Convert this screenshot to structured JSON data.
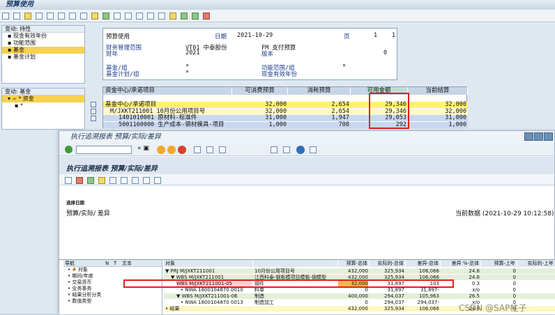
{
  "win1": {
    "title": "预算使用",
    "tree1": {
      "header": "变动: 持性",
      "items": [
        "现金有效年份",
        "功能范围",
        "基金",
        "基金计划"
      ],
      "selected_index": 2
    },
    "tree2": {
      "header": "变动: 基金",
      "items": [
        "* 资金",
        "*"
      ]
    },
    "header_panel": {
      "title": "预算使用",
      "date_label": "日期",
      "date": "2021-10-29",
      "page_label": "页",
      "page": "1",
      "page_of": "1",
      "fm_area_label": "财务管理范围",
      "fm_area": "VT01 中泰股份",
      "fm_label": "FM 支付预算",
      "year_label": "财年",
      "year": "2021",
      "version_label": "版本",
      "version": "0",
      "fund_label": "基金/组",
      "fund": "*",
      "func_label": "功能范围/组",
      "func": "*",
      "fundplan_label": "基金计划/组",
      "fundplan": "*",
      "valid_label": "现金有效年份"
    },
    "grid": {
      "headers": [
        "资金中心/承诺项目",
        "可消费预算",
        "消耗预算",
        "可用金额",
        "当前结算"
      ],
      "rows": [
        {
          "c0": "基金中心/承诺项目",
          "c1": "32,000",
          "c2": "2,654",
          "c3": "29,346",
          "c4": "32,000",
          "style": "yellow"
        },
        {
          "c0": "M/JXKT211001   10月份公用项目号",
          "c1": "32,000",
          "c2": "2,654",
          "c3": "29,346",
          "c4": "32,000",
          "style": "lightyellow"
        },
        {
          "c0": "1401010001   原材料-标准件",
          "c1": "31,000",
          "c2": "1,947",
          "c3": "29,053",
          "c4": "31,000",
          "style": "blue"
        },
        {
          "c0": "5001160000   生产成本-钢材模具-项目",
          "c1": "1,000",
          "c2": "708",
          "c3": "292",
          "c4": "1,000",
          "style": "blue"
        }
      ]
    }
  },
  "win2": {
    "title": "执行追溯报表 预算/实际/差异",
    "heading": "执行追溯报表 预算/实际/差异",
    "section_label": "选择日期",
    "subtitle": "预算/实际/ 差异",
    "current_data": "当前数据 (2021-10-29 10:12:58)",
    "nav": {
      "headers": [
        "导航",
        "N",
        "T",
        "文本"
      ],
      "items": [
        "对象",
        "期间/年度",
        "交易货币",
        "业务事务",
        "结果分析分类",
        "数值类型"
      ]
    },
    "grid": {
      "headers": [
        "对象",
        "",
        "预算-总体",
        "实际的-总体",
        "差异-总体",
        "差异 %-总体",
        "预算-上年",
        "实际的-上年"
      ],
      "rows": [
        {
          "obj": "▼ PRJ M/JXKT211001",
          "txt": "10月份公用项目号",
          "b": "432,000",
          "a": "325,934",
          "d": "106,066",
          "p": "24.6",
          "by": "0",
          "ay": "",
          "style": "lightgreen",
          "indent": 0
        },
        {
          "obj": "▼ WBS M/JXKT211001",
          "txt": "江西科泰-钢板模项目模板-钢模型",
          "b": "432,000",
          "a": "325,934",
          "d": "106,066",
          "p": "24.6",
          "by": "0",
          "ay": "",
          "style": "lightgreen",
          "indent": 8
        },
        {
          "obj": "WBS M/JXKT211001-05",
          "txt": "钢件",
          "b": "32,000",
          "a": "31,897",
          "d": "103",
          "p": "0.3",
          "by": "0",
          "ay": "",
          "style": "selected",
          "indent": 16
        },
        {
          "obj": "• NWA 1800104870 0010",
          "txt": "料单",
          "b": "0",
          "a": "31,897",
          "d": "31,897-",
          "p": "x/o",
          "by": "0",
          "ay": "",
          "style": "white",
          "indent": 22
        },
        {
          "obj": "▼ WBS M/JXKT211001-06",
          "txt": "制造",
          "b": "400,000",
          "a": "294,037",
          "d": "105,963",
          "p": "26.5",
          "by": "0",
          "ay": "",
          "style": "lightgreen",
          "indent": 16
        },
        {
          "obj": "• NWA 1800104870 0013",
          "txt": "制造加工",
          "b": "0",
          "a": "294,037",
          "d": "294,037-",
          "p": "x/o",
          "by": "0",
          "ay": "",
          "style": "white",
          "indent": 22
        },
        {
          "obj": "• 结果",
          "txt": "",
          "b": "432,000",
          "a": "325,934",
          "d": "106,066",
          "p": "24.6",
          "by": "0",
          "ay": "",
          "style": "yellow",
          "indent": 0
        }
      ]
    }
  },
  "watermark": "CSDN @SAP柱子",
  "colors": {
    "highlight_red": "#e0201a",
    "yellow": "#fff36b",
    "selected_orange": "#f6b64a"
  }
}
